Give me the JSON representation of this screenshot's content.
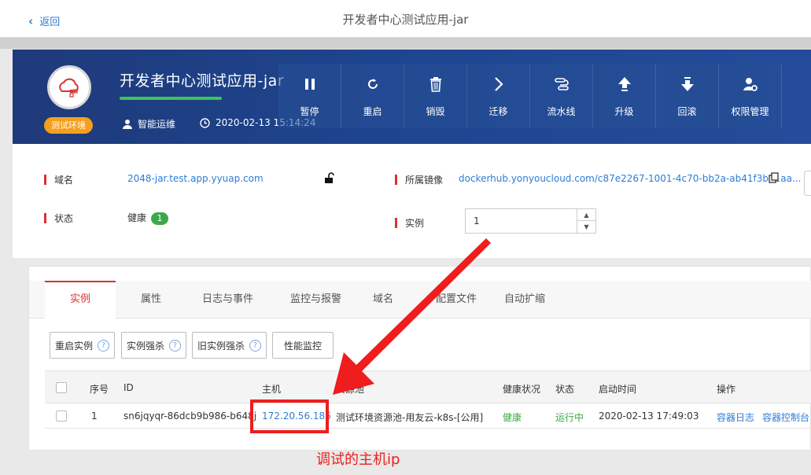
{
  "topbar": {
    "back_label": "返回",
    "title": "开发者中心测试应用-jar"
  },
  "banner": {
    "app_name": "开发者中心测试应用-jar",
    "env_badge": "测试环境",
    "owner": "智能运维",
    "timestamp": "2020-02-13 15:14:24",
    "progress_fraction": 1.0,
    "actions": [
      {
        "icon": "pause-icon",
        "label": "暂停"
      },
      {
        "icon": "restart-icon",
        "label": "重启"
      },
      {
        "icon": "trash-icon",
        "label": "销毁"
      },
      {
        "icon": "chevron-right-icon",
        "label": "迁移"
      },
      {
        "icon": "pipeline-icon",
        "label": "流水线"
      },
      {
        "icon": "upgrade-icon",
        "label": "升级"
      },
      {
        "icon": "rollback-icon",
        "label": "回滚"
      },
      {
        "icon": "user-gear-icon",
        "label": "权限管理"
      }
    ]
  },
  "info": {
    "domain_label": "域名",
    "domain_value": "2048-jar.test.app.yyuap.com",
    "image_label": "所属镜像",
    "image_value": "dockerhub.yonyoucloud.com/c87e2267-1001-4c70-bb2a-ab41f3b81aa...",
    "status_label": "状态",
    "status_value": "健康",
    "status_count": "1",
    "instance_label": "实例",
    "instance_value": "1"
  },
  "tabs": [
    "实例",
    "属性",
    "日志与事件",
    "监控与报警",
    "域名",
    "配置文件",
    "自动扩缩"
  ],
  "buttons": [
    "重启实例",
    "实例强杀",
    "旧实例强杀",
    "性能监控"
  ],
  "table": {
    "headers": [
      "序号",
      "ID",
      "主机",
      "资源池",
      "健康状况",
      "状态",
      "启动时间",
      "操作"
    ],
    "rows": [
      {
        "index": "1",
        "id": "sn6jqyqr-86dcb9b986-b648j",
        "host": "172.20.56.186",
        "pool": "测试环境资源池-用友云-k8s-[公用]",
        "health": "健康",
        "status": "运行中",
        "start_time": "2020-02-13 17:49:03",
        "op1": "容器日志",
        "op2": "容器控制台"
      }
    ]
  },
  "annotation": {
    "text": "调试的主机ip",
    "color": "#ef1d1d"
  },
  "colors": {
    "accent": "#d8322f",
    "link": "#2e7cd6",
    "healthy": "#3ba94a",
    "badge": "#f4a01e"
  }
}
